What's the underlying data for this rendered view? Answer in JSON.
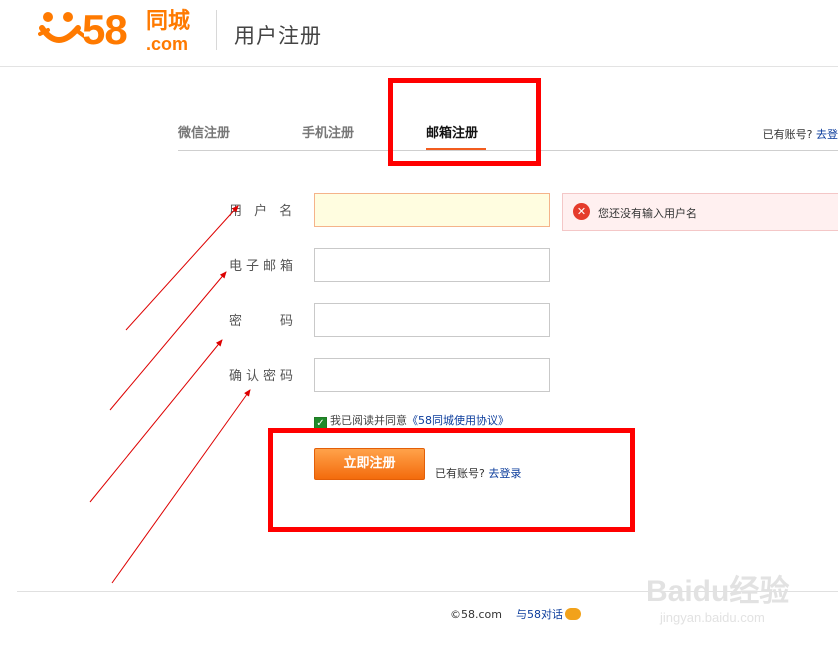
{
  "header": {
    "logo_number": "58",
    "logo_cn": "同城",
    "logo_com": ".com",
    "title": "用户注册"
  },
  "tabs": {
    "items": [
      {
        "label": "微信注册"
      },
      {
        "label": "手机注册"
      },
      {
        "label": "邮箱注册"
      }
    ],
    "active_index": 2,
    "have_account": "已有账号?",
    "login_link": "去登"
  },
  "form": {
    "username_label": "用 户 名",
    "email_label": "电子邮箱",
    "password_label": "密　　码",
    "confirm_label": "确认密码",
    "username_value": "",
    "email_value": "",
    "password_value": "",
    "confirm_value": "",
    "error_message": "您还没有输入用户名",
    "agree_checked": true,
    "agree_text": "我已阅读并同意",
    "agreement_link": "《58同城使用协议》",
    "submit_label": "立即注册",
    "have_account": "已有账号?",
    "login_link": "去登录"
  },
  "footer": {
    "copyright": "©58.com",
    "feedback_link": "与58对话"
  },
  "watermark": {
    "line1": "Baidu经验",
    "line2": "jingyan.baidu.com"
  },
  "colors": {
    "brand": "#ff7a00",
    "annotation": "#ff0000",
    "tab_underline": "#f25c1f"
  }
}
